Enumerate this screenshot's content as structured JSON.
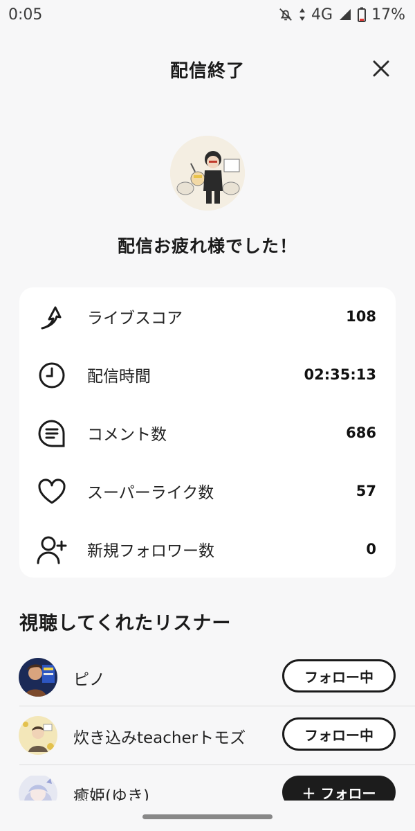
{
  "status_bar": {
    "time": "0:05",
    "network": "4G",
    "battery": "17%"
  },
  "header": {
    "title": "配信終了"
  },
  "greeting": "配信お疲れ様でした！",
  "stats": [
    {
      "icon": "live-score-icon",
      "label": "ライブスコア",
      "value": "108"
    },
    {
      "icon": "clock-icon",
      "label": "配信時間",
      "value": "02:35:13"
    },
    {
      "icon": "comment-icon",
      "label": "コメント数",
      "value": "686"
    },
    {
      "icon": "heart-icon",
      "label": "スーパーライク数",
      "value": "57"
    },
    {
      "icon": "add-user-icon",
      "label": "新規フォロワー数",
      "value": "0"
    }
  ],
  "listeners_section": {
    "title": "視聴してくれたリスナー",
    "items": [
      {
        "name": "ピノ",
        "button": "フォロー中"
      },
      {
        "name": "炊き込みteacherトモズ",
        "button": "フォロー中"
      },
      {
        "name": "癒姫(ゆき)",
        "button": "＋ フォロー"
      }
    ]
  },
  "colors": {
    "background": "#f7f7f8",
    "card": "#ffffff",
    "dark_button": "#1c1c1c"
  }
}
